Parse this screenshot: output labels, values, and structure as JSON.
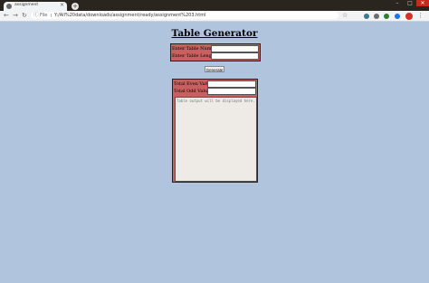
{
  "browser": {
    "tab_title": "assignment",
    "tab_close": "×",
    "new_tab": "+",
    "window_min": "–",
    "window_max": "□",
    "window_close": "✕",
    "nav_back": "←",
    "nav_forward": "→",
    "nav_reload": "↻",
    "address_label": "File",
    "url": "Y:/All%20data/downloads/assignment/ready/assignment%203.html",
    "star": "☆",
    "menu": "⋮"
  },
  "page": {
    "title": "Table Generator",
    "fields": {
      "table_number_label": "Enter Table Number:",
      "table_number_value": "",
      "table_length_label": "Enter Table Length:",
      "table_length_value": ""
    },
    "generate_label": "Generate",
    "output": {
      "even_label": "Total Even Values:",
      "even_value": "",
      "odd_label": "Total Odd Values:",
      "odd_value": "",
      "placeholder": "Table output will be displayed here."
    }
  },
  "colors": {
    "page_background": "#b0c4de",
    "panel_background": "#c86060",
    "output_area": "#eeebe6"
  }
}
